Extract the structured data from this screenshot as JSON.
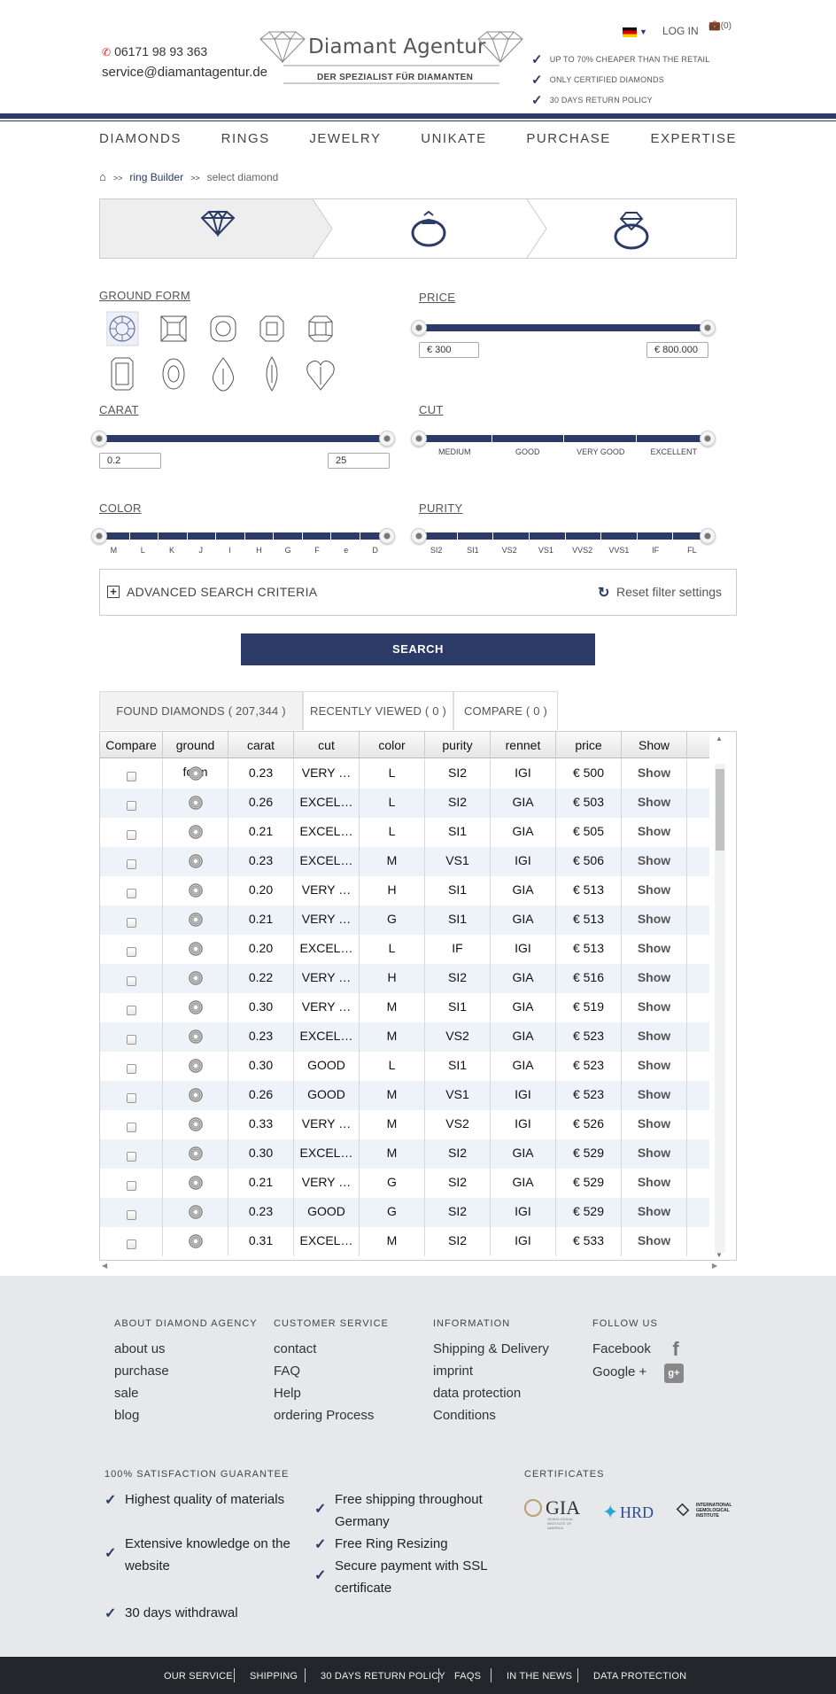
{
  "header": {
    "phone": "06171 98 93 363",
    "email": "service@diamantagentur.de",
    "logo_title": "Diamant Agentur",
    "logo_sub": "DER SPEZIALIST FÜR DIAMANTEN",
    "login": "LOG IN",
    "cart": "(0)",
    "usps": [
      "UP TO 70% CHEAPER THAN THE RETAIL",
      "ONLY CERTIFIED DIAMONDS",
      "30 DAYS RETURN POLICY"
    ]
  },
  "nav": [
    "DIAMONDS",
    "RINGS",
    "JEWELRY",
    "UNIKATE",
    "PURCHASE",
    "EXPERTISE"
  ],
  "breadcrumb": {
    "sep": ">>",
    "link": "ring Builder",
    "current": "select diamond"
  },
  "filters": {
    "ground_form": {
      "label": "GROUND FORM",
      "shapes": [
        "round-shape-icon",
        "princess-shape-icon",
        "cushion-shape-icon",
        "asscher-shape-icon",
        "radiant-shape-icon",
        "emerald-shape-icon",
        "oval-shape-icon",
        "pear-shape-icon",
        "marquise-shape-icon",
        "heart-shape-icon"
      ]
    },
    "price": {
      "label": "PRICE",
      "min": "€ 300",
      "max": "€ 800.000"
    },
    "carat": {
      "label": "CARAT",
      "min": "0.2",
      "max": "25"
    },
    "cut": {
      "label": "CUT",
      "ticks": [
        "MEDIUM",
        "GOOD",
        "VERY GOOD",
        "EXCELLENT"
      ]
    },
    "color": {
      "label": "COLOR",
      "ticks": [
        "M",
        "L",
        "K",
        "J",
        "I",
        "H",
        "G",
        "F",
        "e",
        "D"
      ]
    },
    "purity": {
      "label": "PURITY",
      "ticks": [
        "SI2",
        "SI1",
        "VS2",
        "VS1",
        "VVS2",
        "VVS1",
        "IF",
        "FL"
      ]
    },
    "advanced": "ADVANCED SEARCH CRITERIA",
    "reset": "Reset filter settings",
    "search": "SEARCH"
  },
  "tabs": [
    "FOUND DIAMONDS ( 207,344 )",
    "RECENTLY VIEWED ( 0 )",
    "COMPARE ( 0 )"
  ],
  "table": {
    "columns": [
      "Compare",
      "ground form",
      "carat",
      "cut",
      "color",
      "purity",
      "rennet",
      "price",
      "Show"
    ],
    "show_label": "Show",
    "rows": [
      [
        "0.23",
        "VERY …",
        "L",
        "SI2",
        "IGI",
        "€ 500"
      ],
      [
        "0.26",
        "EXCEL…",
        "L",
        "SI2",
        "GIA",
        "€ 503"
      ],
      [
        "0.21",
        "EXCEL…",
        "L",
        "SI1",
        "GIA",
        "€ 505"
      ],
      [
        "0.23",
        "EXCEL…",
        "M",
        "VS1",
        "IGI",
        "€ 506"
      ],
      [
        "0.20",
        "VERY …",
        "H",
        "SI1",
        "GIA",
        "€ 513"
      ],
      [
        "0.21",
        "VERY …",
        "G",
        "SI1",
        "GIA",
        "€ 513"
      ],
      [
        "0.20",
        "EXCEL…",
        "L",
        "IF",
        "IGI",
        "€ 513"
      ],
      [
        "0.22",
        "VERY …",
        "H",
        "SI2",
        "GIA",
        "€ 516"
      ],
      [
        "0.30",
        "VERY …",
        "M",
        "SI1",
        "GIA",
        "€ 519"
      ],
      [
        "0.23",
        "EXCEL…",
        "M",
        "VS2",
        "GIA",
        "€ 523"
      ],
      [
        "0.30",
        "GOOD",
        "L",
        "SI1",
        "GIA",
        "€ 523"
      ],
      [
        "0.26",
        "GOOD",
        "M",
        "VS1",
        "IGI",
        "€ 523"
      ],
      [
        "0.33",
        "VERY …",
        "M",
        "VS2",
        "IGI",
        "€ 526"
      ],
      [
        "0.30",
        "EXCEL…",
        "M",
        "SI2",
        "GIA",
        "€ 529"
      ],
      [
        "0.21",
        "VERY …",
        "G",
        "SI2",
        "GIA",
        "€ 529"
      ],
      [
        "0.23",
        "GOOD",
        "G",
        "SI2",
        "IGI",
        "€ 529"
      ],
      [
        "0.31",
        "EXCEL…",
        "M",
        "SI2",
        "IGI",
        "€ 533"
      ]
    ]
  },
  "footer": {
    "about": {
      "title": "ABOUT DIAMOND AGENCY",
      "links": [
        "about us",
        "purchase",
        "sale",
        "blog"
      ]
    },
    "service": {
      "title": "CUSTOMER SERVICE",
      "links": [
        "contact",
        "FAQ",
        "Help",
        "ordering Process"
      ]
    },
    "info": {
      "title": "INFORMATION",
      "links": [
        "Shipping & Delivery",
        "imprint",
        "data protection",
        "Conditions"
      ]
    },
    "follow": {
      "title": "FOLLOW US",
      "links": [
        "Facebook",
        "Google +"
      ]
    },
    "guarantee": {
      "title": "100% SATISFACTION GUARANTEE",
      "col1": [
        "Highest quality of materials",
        "Extensive knowledge on the website",
        "30 days withdrawal"
      ],
      "col2": [
        "Free shipping throughout Germany",
        "Free Ring Resizing",
        "Secure payment with SSL certificate"
      ]
    },
    "certificates": {
      "title": "CERTIFICATES",
      "gia": "GIA",
      "gia_sub": "GEMOLOGICAL INSTITUTE OF AMERICA",
      "hrd": "HRD",
      "igi": "INTERNATIONAL GEMOLOGICAL INSTITUTE"
    },
    "bottom": [
      "OUR SERVICE",
      "SHIPPING",
      "30 DAYS RETURN POLICY",
      "FAQS",
      "IN THE NEWS",
      "DATA PROTECTION"
    ]
  },
  "colors": {
    "accent": "#2b3a67",
    "footer_bg": "#e6e8eb",
    "bottom_bar": "#23262b"
  }
}
